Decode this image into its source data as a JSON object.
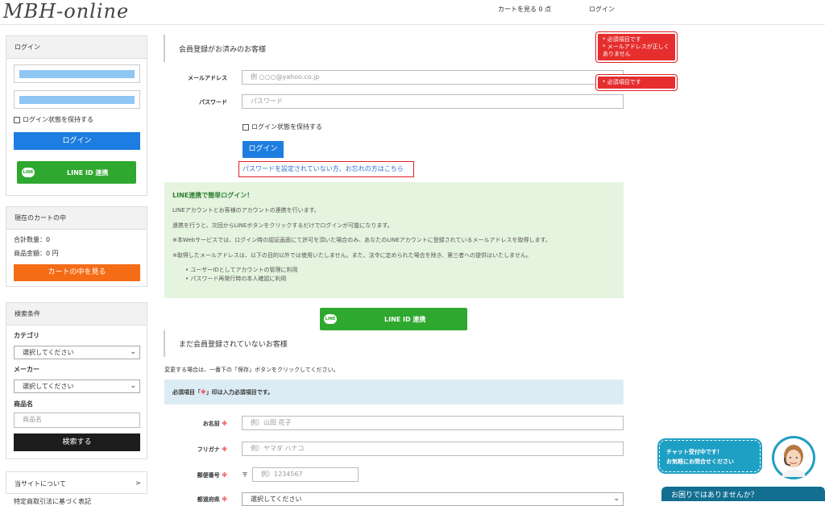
{
  "header": {
    "logo": "MBH-online",
    "cart_link": "カートを見る 0 点",
    "login_link": "ログイン"
  },
  "sidebar": {
    "login_box": {
      "title": "ログイン",
      "keep_login": "ログイン状態を保持する",
      "login_button": "ログイン",
      "line_button": "LINE ID 連携",
      "line_icon": "LINE"
    },
    "cart_box": {
      "title": "現在のカートの中",
      "total_qty": "合計数量：0",
      "total_price": "商品金額：0 円",
      "view_cart": "カートの中を見る"
    },
    "search_box": {
      "title": "検索条件",
      "category_label": "カテゴリ",
      "category_value": "選択してください",
      "maker_label": "メーカー",
      "maker_value": "選択してください",
      "product_label": "商品名",
      "product_placeholder": "商品名",
      "search_button": "検索する"
    },
    "about": {
      "label": "当サイトについて",
      "arrow": ">"
    },
    "cut_text": "特定商取引法に基づく表記"
  },
  "main": {
    "member_title": "会員登録がお済みのお客様",
    "email_label": "メールアドレス",
    "email_placeholder": "例 ○○○@yahoo.co.jp",
    "password_label": "パスワード",
    "password_placeholder": "パスワード",
    "keep_login": "ログイン状態を保持する",
    "login_button": "ログイン",
    "forgot_link": "パスワードを設定されていない方、お忘れの方はこちら",
    "error_email_1": "* 必須項目です",
    "error_email_2": "* メールアドレスが正しくありません",
    "error_password": "* 必須項目です",
    "line_info": {
      "title": "LINE連携で簡単ログイン！",
      "p1": "LINEアカウントとお客様のアカウントの連携を行います。",
      "p2": "連携を行うと、次回からLINEボタンをクリックするだけでログインが可能になります。",
      "p3": "※本Webサービスでは、ログイン時の認証画面にて許可を頂いた場合のみ、あなたのLINEアカウントに登録されているメールアドレスを取得します。",
      "p4": "※取得したメールアドレスは、以下の目的以外では使用いたしません。また、法令に定められた場合を除き、第三者への提供はいたしません。",
      "bullets": [
        "ユーザーIDとしてアカウントの管理に利用",
        "パスワード再発行時の本人確認に利用"
      ]
    },
    "line_button": "LINE ID 連携",
    "line_icon": "LINE",
    "non_member_title": "まだ会員登録されていないお客様",
    "save_note": "変更する場合は、一番下の「保存」ボタンをクリックしてください。",
    "required_note_pre": "必須項目「",
    "required_mark": "※",
    "required_note_post": "」印は入力必須項目です。",
    "name_label": "お名前",
    "name_placeholder": "例）山田 花子",
    "kana_label": "フリガナ",
    "kana_placeholder": "例）ヤマダ ハナコ",
    "zip_label": "郵便番号",
    "zip_prefix": "〒",
    "zip_placeholder": "例）1234567",
    "pref_label": "都道府県",
    "pref_value": "選択してください"
  },
  "chat": {
    "bubble_line1": "チャット受付中です！",
    "bubble_line2": "お気軽にお問合せください",
    "bar_label": "お困りではありませんか？"
  }
}
